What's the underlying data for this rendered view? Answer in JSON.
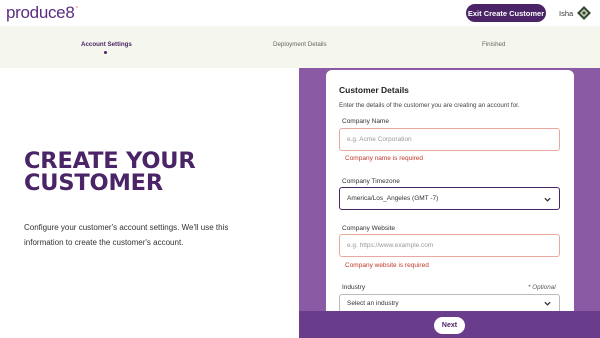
{
  "header": {
    "logo_text": "produce8",
    "logo_mark": "°",
    "exit_button": "Exit Create Customer",
    "user_name": "Isha"
  },
  "steps": [
    {
      "label": "Account Settings",
      "active": true
    },
    {
      "label": "Deployment Details",
      "active": false
    },
    {
      "label": "Finished",
      "active": false
    }
  ],
  "hero": {
    "title_line1": "CREATE YOUR",
    "title_line2": "CUSTOMER",
    "intro": "Configure your customer's account settings. We'll use this information to create the customer's account."
  },
  "form": {
    "title": "Customer Details",
    "description": "Enter the details of the customer you are creating an account for.",
    "company_name": {
      "label": "Company Name",
      "placeholder": "e.g. Acme Corporation",
      "value": "",
      "error": "Company name is required"
    },
    "company_timezone": {
      "label": "Company Timezone",
      "value": "America/Los_Angeles (GMT -7)"
    },
    "company_website": {
      "label": "Company Website",
      "placeholder": "e.g. https://www.example.com",
      "value": "",
      "error": "Company website is required"
    },
    "industry": {
      "label": "Industry",
      "optional": "* Optional",
      "value": "Select an industry"
    }
  },
  "footer": {
    "next_button": "Next"
  },
  "colors": {
    "brand_purple": "#4a2466",
    "panel_purple": "#8a5aa5",
    "error_red": "#c0392b",
    "steps_bg": "#f5f6ee"
  }
}
